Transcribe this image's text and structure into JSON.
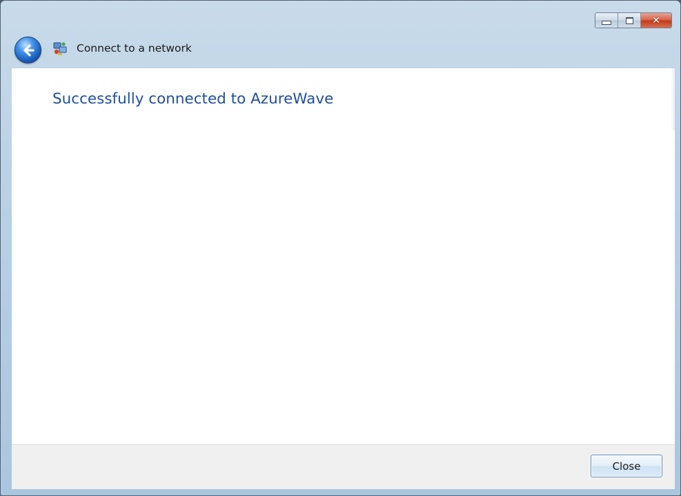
{
  "window": {
    "title": "Connect to a network",
    "controls": {
      "minimize_icon": "minimize-icon",
      "maximize_icon": "maximize-icon",
      "close_glyph": "✕"
    }
  },
  "content": {
    "heading": "Successfully connected to AzureWave"
  },
  "footer": {
    "close_label": "Close"
  },
  "colors": {
    "heading": "#1e4f9c",
    "frame": "#b4cde3",
    "footer": "#f0f0f0"
  }
}
